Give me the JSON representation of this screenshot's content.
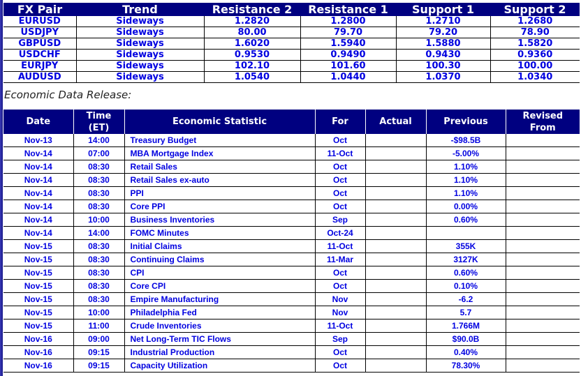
{
  "fx_table": {
    "headers": [
      "FX Pair",
      "Trend",
      "Resistance 2",
      "Resistance 1",
      "Support 1",
      "Support 2"
    ],
    "rows": [
      [
        "EURUSD",
        "Sideways",
        "1.2820",
        "1.2800",
        "1.2710",
        "1.2680"
      ],
      [
        "USDJPY",
        "Sideways",
        "80.00",
        "79.70",
        "79.20",
        "78.90"
      ],
      [
        "GBPUSD",
        "Sideways",
        "1.6020",
        "1.5940",
        "1.5880",
        "1.5820"
      ],
      [
        "USDCHF",
        "Sideways",
        "0.9530",
        "0.9490",
        "0.9430",
        "0.9360"
      ],
      [
        "EURJPY",
        "Sideways",
        "102.10",
        "101.60",
        "100.30",
        "100.00"
      ],
      [
        "AUDUSD",
        "Sideways",
        "1.0540",
        "1.0440",
        "1.0370",
        "1.0340"
      ]
    ]
  },
  "section_label": "Economic Data Release:",
  "econ_table": {
    "headers": [
      "Date",
      "Time (ET)",
      "Economic Statistic",
      "For",
      "Actual",
      "Previous",
      "Revised From"
    ],
    "rows": [
      [
        "Nov-13",
        "14:00",
        "Treasury Budget",
        "Oct",
        "",
        "-$98.5B",
        ""
      ],
      [
        "Nov-14",
        "07:00",
        "MBA Mortgage Index",
        "11-Oct",
        "",
        "-5.00%",
        ""
      ],
      [
        "Nov-14",
        "08:30",
        "Retail Sales",
        "Oct",
        "",
        "1.10%",
        ""
      ],
      [
        "Nov-14",
        "08:30",
        "Retail Sales ex-auto",
        "Oct",
        "",
        "1.10%",
        ""
      ],
      [
        "Nov-14",
        "08:30",
        "PPI",
        "Oct",
        "",
        "1.10%",
        ""
      ],
      [
        "Nov-14",
        "08:30",
        "Core PPI",
        "Oct",
        "",
        "0.00%",
        ""
      ],
      [
        "Nov-14",
        "10:00",
        "Business Inventories",
        "Sep",
        "",
        "0.60%",
        ""
      ],
      [
        "Nov-14",
        "14:00",
        "FOMC Minutes",
        "Oct-24",
        "",
        "",
        ""
      ],
      [
        "Nov-15",
        "08:30",
        "Initial Claims",
        "11-Oct",
        "",
        "355K",
        ""
      ],
      [
        "Nov-15",
        "08:30",
        "Continuing Claims",
        "11-Mar",
        "",
        "3127K",
        ""
      ],
      [
        "Nov-15",
        "08:30",
        "CPI",
        "Oct",
        "",
        "0.60%",
        ""
      ],
      [
        "Nov-15",
        "08:30",
        "Core CPI",
        "Oct",
        "",
        "0.10%",
        ""
      ],
      [
        "Nov-15",
        "08:30",
        "Empire Manufacturing",
        "Nov",
        "",
        "-6.2",
        ""
      ],
      [
        "Nov-15",
        "10:00",
        "Philadelphia Fed",
        "Nov",
        "",
        "5.7",
        ""
      ],
      [
        "Nov-15",
        "11:00",
        "Crude Inventories",
        "11-Oct",
        "",
        "1.766M",
        ""
      ],
      [
        "Nov-16",
        "09:00",
        "Net Long-Term TIC Flows",
        "Sep",
        "",
        "$90.0B",
        ""
      ],
      [
        "Nov-16",
        "09:15",
        "Industrial Production",
        "Oct",
        "",
        "0.40%",
        ""
      ],
      [
        "Nov-16",
        "09:15",
        "Capacity Utilization",
        "Oct",
        "",
        "78.30%",
        ""
      ]
    ]
  },
  "colors": {
    "header_bg": "#000080",
    "header_text": "#ffffff",
    "cell_text": "#0000e0"
  }
}
